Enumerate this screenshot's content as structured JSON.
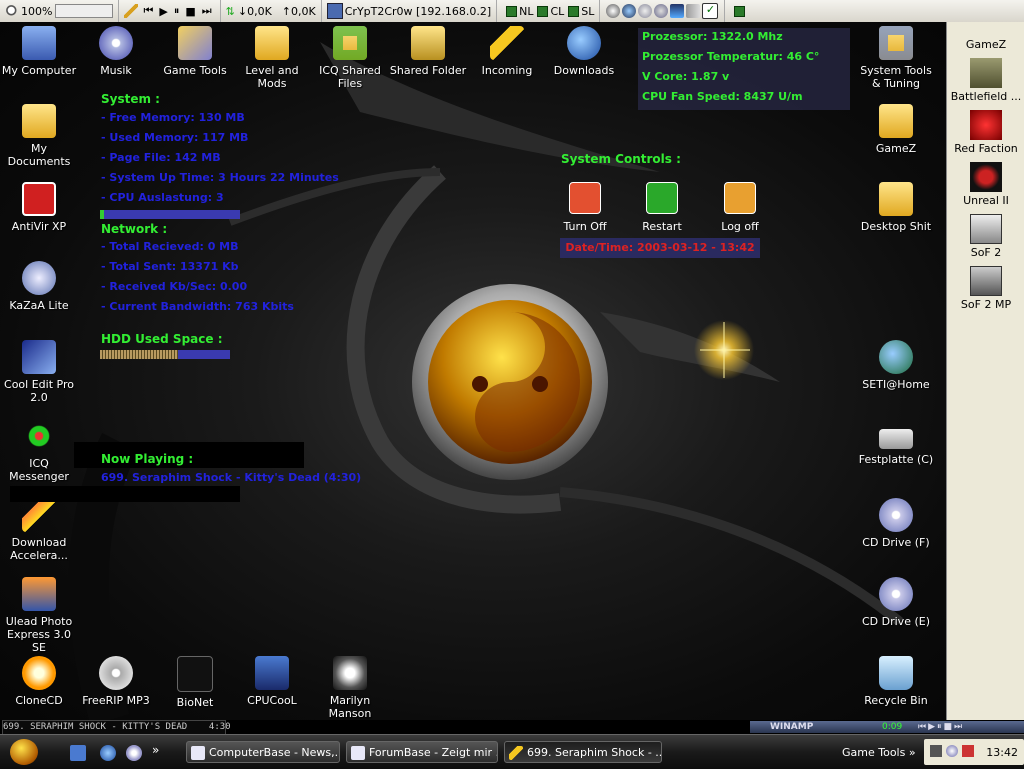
{
  "topbar": {
    "zoom": "100%",
    "download_rate": "0,0K",
    "upload_rate": "0,0K",
    "host": "CrYpT2Cr0w [192.168.0.2]",
    "toggles": [
      "NL",
      "CL",
      "SL"
    ]
  },
  "desktop": {
    "icons_left": [
      "My Computer",
      "Musik",
      "Game Tools",
      "Level and Mods",
      "ICQ Shared Files",
      "Shared Folder",
      "Incoming",
      "Downloads"
    ],
    "icons_col": [
      "My Documents",
      "AntiVir XP",
      "KaZaA Lite",
      "Cool Edit Pro 2.0",
      "ICQ Messenger",
      "Download Accelera...",
      "Ulead Photo Express 3.0 SE",
      "CloneCD"
    ],
    "icons_bottom": [
      "FreeRIP MP3",
      "BioNet",
      "CPUCooL",
      "Marilyn Manson"
    ],
    "icons_right": [
      "System Tools & Tuning",
      "GameZ",
      "Desktop Shit",
      "SETI@Home",
      "Festplatte (C)",
      "CD Drive (F)",
      "CD Drive (E)",
      "Recycle Bin"
    ]
  },
  "system": {
    "header": "System :",
    "lines": [
      "- Free Memory: 130 MB",
      "- Used Memory: 117 MB",
      "- Page File: 142 MB",
      "- System Up Time: 3 Hours 22 Minutes",
      "- CPU Auslastung: 3"
    ],
    "cpu_load_fraction": 0.03
  },
  "network": {
    "header": "Network :",
    "lines": [
      "- Total Recieved: 0 MB",
      "- Total Sent: 13371 Kb",
      "- Received Kb/Sec: 0.00",
      "- Current Bandwidth: 763 Kbits"
    ]
  },
  "hdd": {
    "header": "HDD Used Space :",
    "used_fraction": 0.6
  },
  "now_playing": {
    "header": "Now Playing :",
    "track": "699. Seraphim Shock - Kitty's Dead (4:30)"
  },
  "cpu_panel": [
    "Prozessor: 1322.0 Mhz",
    "Prozessor Temperatur: 46 C°",
    "V Core: 1.87 v",
    "CPU Fan Speed: 8437 U/m"
  ],
  "controls": {
    "header": "System Controls :",
    "turn_off": "Turn Off",
    "restart": "Restart",
    "log_off": "Log off",
    "datetime": "Date/Time: 2003-03-12 - 13:42"
  },
  "sidebar": {
    "title": "GameZ",
    "items": [
      "Battlefield ...",
      "Red Faction",
      "Unreal II",
      "SoF 2",
      "SoF 2 MP"
    ]
  },
  "winamp": {
    "title_scroll": "699. SERAPHIM SHOCK - KITTY'S DEAD    4:30",
    "label": "WINAMP",
    "time": "0:09"
  },
  "taskbar": {
    "tasks": [
      "ComputerBase - News,...",
      "ForumBase - Zeigt mir ...",
      "699. Seraphim Shock - ..."
    ],
    "toolbar": "Game Tools",
    "clock": "13:42"
  },
  "colors": {
    "stat_green": "#33ee33",
    "stat_blue": "#2222dd",
    "datetime_red": "#dd2222"
  }
}
